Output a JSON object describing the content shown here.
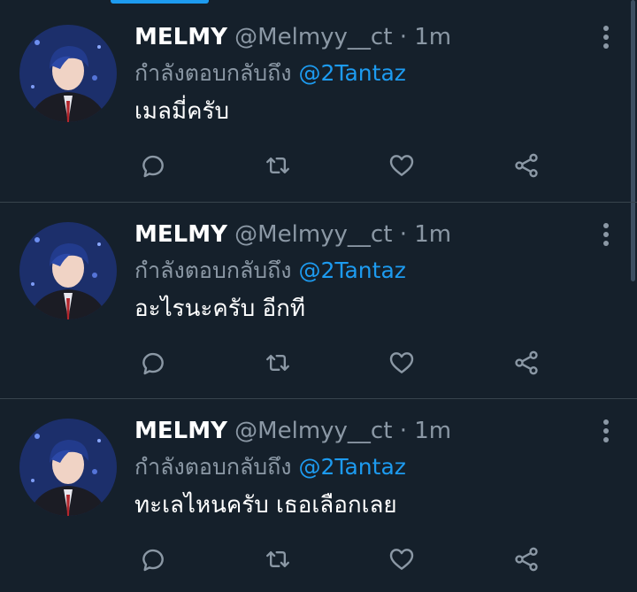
{
  "tweets": [
    {
      "display_name": "MELMY",
      "handle": "@Melmyy__ct",
      "separator": "·",
      "time": "1m",
      "reply_prefix": "กำลังตอบกลับถึง",
      "reply_to": "@2Tantaz",
      "text": "เมลมี่ครับ"
    },
    {
      "display_name": "MELMY",
      "handle": "@Melmyy__ct",
      "separator": "·",
      "time": "1m",
      "reply_prefix": "กำลังตอบกลับถึง",
      "reply_to": "@2Tantaz",
      "text": "อะไรนะครับ อีกที"
    },
    {
      "display_name": "MELMY",
      "handle": "@Melmyy__ct",
      "separator": "·",
      "time": "1m",
      "reply_prefix": "กำลังตอบกลับถึง",
      "reply_to": "@2Tantaz",
      "text": "ทะเลไหนครับ เธอเลือกเลย"
    }
  ],
  "icons": {
    "reply": "reply-icon",
    "retweet": "retweet-icon",
    "like": "heart-icon",
    "share": "share-icon",
    "more": "more-vertical-icon"
  },
  "colors": {
    "background": "#15202b",
    "divider": "#38444d",
    "muted": "#8b98a5",
    "accent": "#1d9bf0",
    "text": "#ffffff"
  }
}
